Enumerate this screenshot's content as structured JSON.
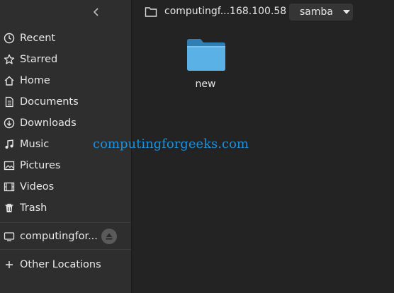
{
  "sidebar": {
    "places": [
      {
        "label": "Recent",
        "icon": "clock-icon"
      },
      {
        "label": "Starred",
        "icon": "star-icon"
      },
      {
        "label": "Home",
        "icon": "home-icon"
      },
      {
        "label": "Documents",
        "icon": "document-icon"
      },
      {
        "label": "Downloads",
        "icon": "download-icon"
      },
      {
        "label": "Music",
        "icon": "music-icon"
      },
      {
        "label": "Pictures",
        "icon": "picture-icon"
      },
      {
        "label": "Videos",
        "icon": "video-icon"
      },
      {
        "label": "Trash",
        "icon": "trash-icon"
      }
    ],
    "network_share": {
      "label": "computingfor...",
      "icon": "network-drive-icon",
      "eject_icon": "eject-icon"
    },
    "other_locations": {
      "label": "Other Locations",
      "icon": "plus-icon"
    }
  },
  "pathbar": {
    "root_label": "computingf...168.100.58",
    "share_label": "samba"
  },
  "content": {
    "items": [
      {
        "name": "new",
        "type": "folder",
        "color": "#4aa8e0"
      }
    ]
  },
  "watermark": {
    "text": "computingforgeeks.com",
    "color": "#1e8fd8"
  }
}
